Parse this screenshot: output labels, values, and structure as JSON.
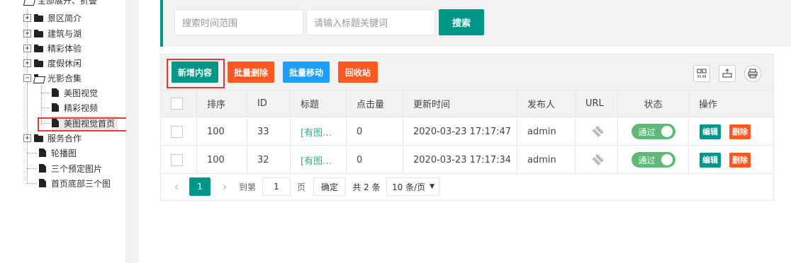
{
  "sidebar": {
    "root_label": "全部展开、折叠",
    "nodes": [
      {
        "label": "景区简介"
      },
      {
        "label": "建筑与湖"
      },
      {
        "label": "精彩体验"
      },
      {
        "label": "度假休闲"
      },
      {
        "label": "光影合集"
      },
      {
        "label": "美图视觉"
      },
      {
        "label": "精彩视频"
      },
      {
        "label": "美图视觉首页"
      },
      {
        "label": "服务合作"
      },
      {
        "label": "轮播图"
      },
      {
        "label": "三个预定图片"
      },
      {
        "label": "首页底部三个图"
      }
    ]
  },
  "search": {
    "time_placeholder": "搜索时间范围",
    "keyword_placeholder": "请输入标题关键词",
    "button_label": "搜索"
  },
  "toolbar": {
    "add_label": "新增内容",
    "batch_delete_label": "批量删除",
    "batch_move_label": "批量移动",
    "recycle_label": "回收站"
  },
  "table": {
    "headers": [
      "排序",
      "ID",
      "标题",
      "点击量",
      "更新时间",
      "发布人",
      "URL",
      "状态",
      "操作"
    ],
    "rows": [
      {
        "sort": "100",
        "id": "33",
        "title": "[有图…",
        "clicks": "0",
        "updated": "2020-03-23 17:17:47",
        "author": "admin",
        "status": "通过",
        "edit": "编辑",
        "delete": "删除"
      },
      {
        "sort": "100",
        "id": "32",
        "title": "[有图…",
        "clicks": "0",
        "updated": "2020-03-23 17:17:34",
        "author": "admin",
        "status": "通过",
        "edit": "编辑",
        "delete": "删除"
      }
    ]
  },
  "pager": {
    "prev": "‹",
    "current": "1",
    "next": "›",
    "goto_label": "到第",
    "goto_value": "1",
    "page_unit": "页",
    "confirm": "确定",
    "total": "共 2 条",
    "page_size": "10 条/页"
  },
  "colors": {
    "primary": "#009688",
    "danger": "#FF5722",
    "info": "#1E9FFF",
    "toggle": "#5FB878",
    "highlight": "#e53935"
  }
}
